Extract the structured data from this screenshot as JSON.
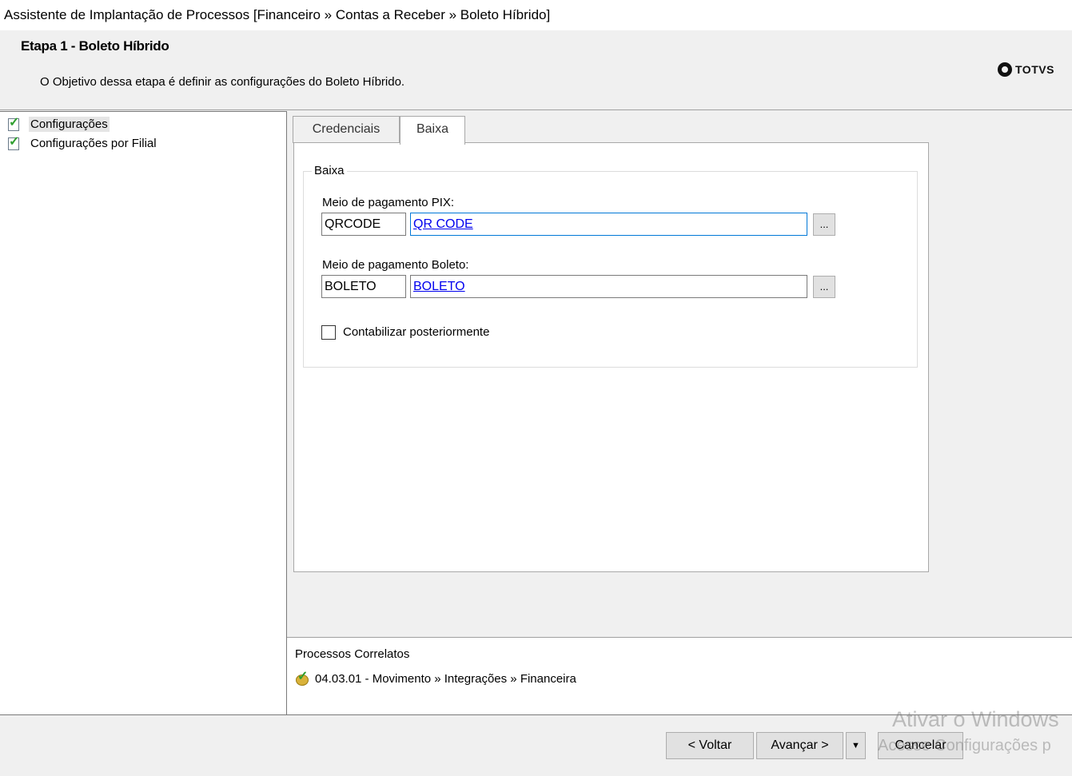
{
  "window": {
    "title": "Assistente de Implantação de Processos [Financeiro » Contas a Receber » Boleto Híbrido]"
  },
  "header": {
    "step_title": "Etapa 1 - Boleto Híbrido",
    "step_description": "O Objetivo dessa etapa é definir as configurações do Boleto Híbrido.",
    "logo_text": "TOTVS"
  },
  "sidebar": {
    "items": [
      {
        "label": "Configurações",
        "icon": "checklist-icon",
        "selected": true
      },
      {
        "label": "Configurações por Filial",
        "icon": "checklist-icon",
        "selected": false
      }
    ]
  },
  "tabs": [
    {
      "label": "Credenciais",
      "active": false
    },
    {
      "label": "Baixa",
      "active": true
    }
  ],
  "baixa": {
    "group_title": "Baixa",
    "pix": {
      "label": "Meio de pagamento PIX:",
      "code": "QRCODE",
      "description": "QR CODE",
      "lookup_label": "..."
    },
    "boleto": {
      "label": "Meio de pagamento Boleto:",
      "code": "BOLETO",
      "description": "BOLETO",
      "lookup_label": "..."
    },
    "contabilizar": {
      "label": "Contabilizar posteriormente",
      "checked": false
    }
  },
  "correlatos": {
    "title": "Processos Correlatos",
    "items": [
      {
        "label": "04.03.01 - Movimento » Integrações » Financeira",
        "icon": "process-icon"
      }
    ]
  },
  "footer": {
    "back_label": "< Voltar",
    "next_label": "Avançar >",
    "dropdown_label": "▼",
    "cancel_label": "Cancelar"
  },
  "watermark": {
    "line1": "Ativar o Windows",
    "line2": "Acesse Configurações p"
  }
}
